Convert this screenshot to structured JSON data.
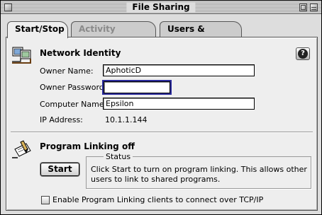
{
  "window": {
    "title": "File Sharing"
  },
  "tabs": [
    {
      "label": "Start/Stop",
      "state": "active"
    },
    {
      "label": "Activity Monitor",
      "state": "disabled"
    },
    {
      "label": "Users & Groups",
      "state": "normal"
    }
  ],
  "network_identity": {
    "heading": "Network Identity",
    "icon": "network-identity-icon",
    "owner_name_label": "Owner Name:",
    "owner_name_value": "AphoticD",
    "owner_password_label": "Owner Password:",
    "owner_password_value": "",
    "computer_name_label": "Computer Name:",
    "computer_name_value": "Epsilon",
    "ip_label": "IP Address:",
    "ip_value": "10.1.1.144"
  },
  "help": {
    "icon": "help-icon",
    "glyph": "?"
  },
  "program_linking": {
    "heading": "Program Linking off",
    "icon": "program-linking-icon",
    "start_label": "Start",
    "status_legend": "Status",
    "status_text": "Click Start to turn on program linking. This allows other users to link to shared programs.",
    "tcp_checkbox_label": "Enable Program Linking clients to connect over TCP/IP",
    "tcp_checked": false
  },
  "colors": {
    "focus_ring": "#2a2a9c",
    "disabled_text": "#8a8a8a"
  }
}
